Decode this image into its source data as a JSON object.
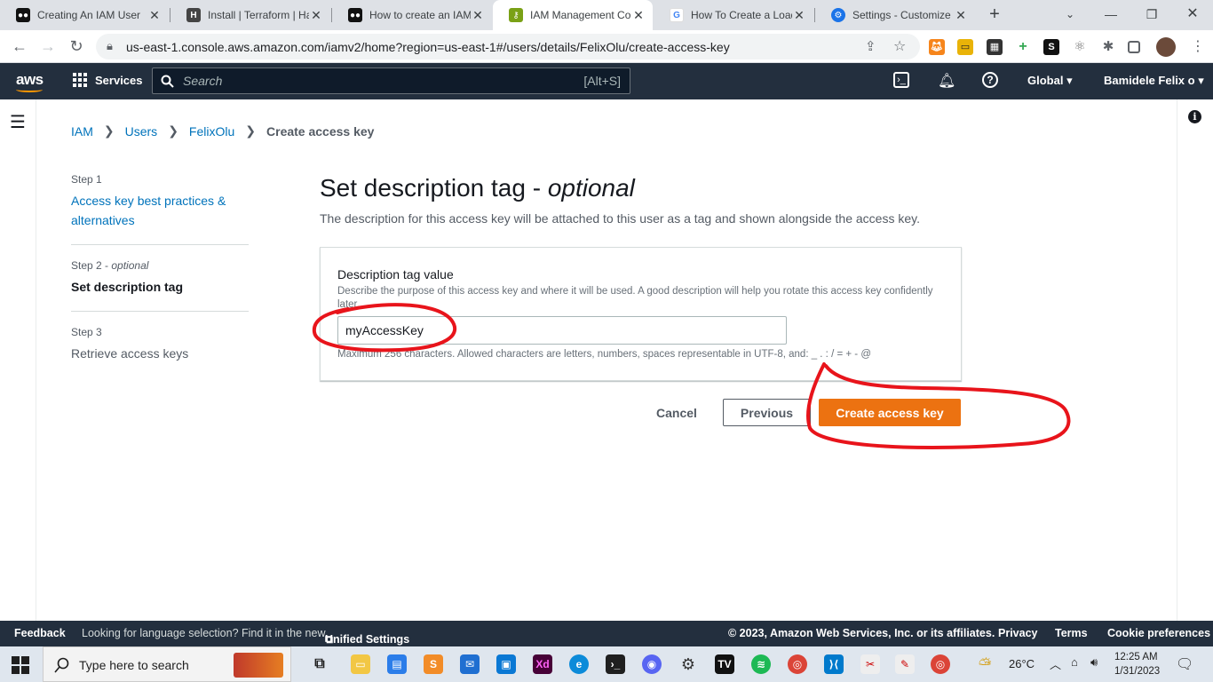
{
  "browser": {
    "tabs": [
      {
        "title": "Creating An IAM User",
        "icon": "medium-icon"
      },
      {
        "title": "Install | Terraform | Ha",
        "icon": "hashicorp-icon"
      },
      {
        "title": "How to create an IAM",
        "icon": "medium-icon"
      },
      {
        "title": "IAM Management Co",
        "icon": "aws-iam-icon",
        "active": true
      },
      {
        "title": "How To Create a Load",
        "icon": "google-icon"
      },
      {
        "title": "Settings - Customize",
        "icon": "settings-gear-icon"
      }
    ],
    "url": "us-east-1.console.aws.amazon.com/iamv2/home?region=us-east-1#/users/details/FelixOlu/create-access-key"
  },
  "aws_header": {
    "logo": "aws",
    "services_label": "Services",
    "search_placeholder": "Search",
    "search_shortcut": "[Alt+S]",
    "region": "Global",
    "account": "Bamidele Felix o"
  },
  "breadcrumb": [
    {
      "label": "IAM"
    },
    {
      "label": "Users"
    },
    {
      "label": "FelixOlu"
    },
    {
      "label": "Create access key"
    }
  ],
  "steps": [
    {
      "number": "Step 1",
      "label": "Access key best practices & alternatives"
    },
    {
      "number": "Step 2",
      "optional": "optional",
      "label": "Set description tag"
    },
    {
      "number": "Step 3",
      "label": "Retrieve access keys"
    }
  ],
  "main": {
    "title": "Set description tag - ",
    "title_emphasis": "optional",
    "description": "The description for this access key will be attached to this user as a tag and shown alongside the access key.",
    "field_label": "Description tag value",
    "field_help": "Describe the purpose of this access key and where it will be used. A good description will help you rotate this access key confidently later.",
    "field_value": "myAccessKey",
    "constraint": "Maximum 256 characters. Allowed characters are letters, numbers, spaces representable in UTF-8, and: _ . : / = + - @",
    "cancel_label": "Cancel",
    "previous_label": "Previous",
    "create_label": "Create access key"
  },
  "footer": {
    "feedback": "Feedback",
    "language_prompt": "Looking for language selection? Find it in the new",
    "unified_settings": "Unified Settings",
    "copyright": "© 2023, Amazon Web Services, Inc. or its affiliates.",
    "privacy": "Privacy",
    "terms": "Terms",
    "cookie": "Cookie preferences"
  },
  "taskbar": {
    "search_placeholder": "Type here to search",
    "temperature": "26°C",
    "time": "12:25 AM",
    "date": "1/31/2023"
  },
  "colors": {
    "aws_nav": "#232f3e",
    "primary_button": "#ec7211",
    "link": "#0073bb",
    "annotation": "#e8141b"
  }
}
